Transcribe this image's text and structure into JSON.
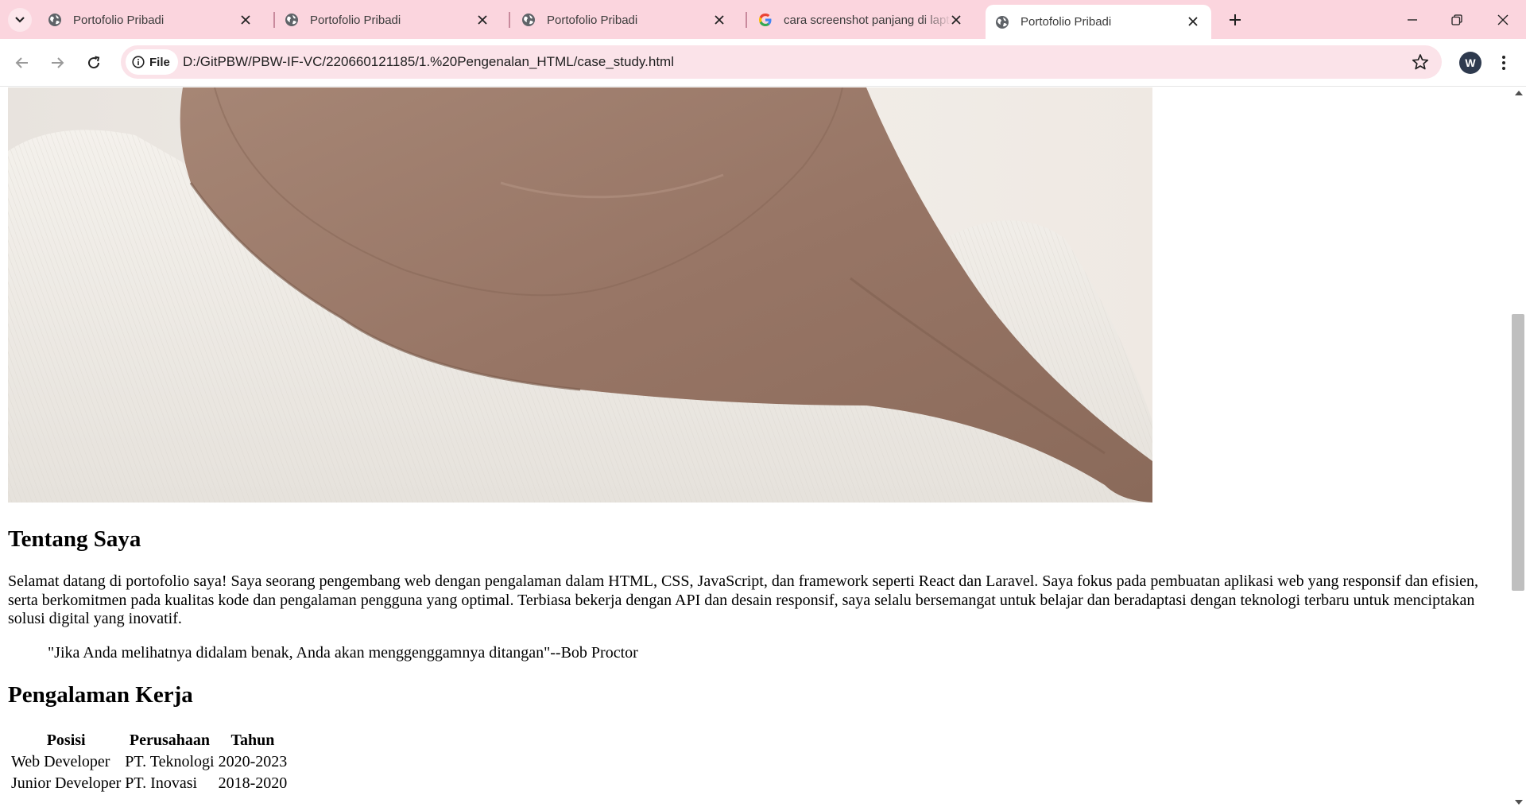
{
  "browser": {
    "tabs": [
      {
        "title": "Portofolio Pribadi",
        "icon": "globe-icon",
        "active": false
      },
      {
        "title": "Portofolio Pribadi",
        "icon": "globe-icon",
        "active": false
      },
      {
        "title": "Portofolio Pribadi",
        "icon": "globe-icon",
        "active": false
      },
      {
        "title": "cara screenshot panjang di laptop",
        "icon": "google-icon",
        "active": false
      },
      {
        "title": "Portofolio Pribadi",
        "icon": "globe-icon",
        "active": true
      }
    ],
    "address": {
      "scheme_label": "File",
      "url": "D:/GitPBW/PBW-IF-VC/220660121185/1.%20Pengenalan_HTML/case_study.html"
    },
    "profile_initial": "W",
    "colors": {
      "tabstrip_bg": "#fbd5de",
      "omnibox_bg": "#fbe3e9",
      "avatar_bg": "#2e3a4e"
    }
  },
  "page": {
    "photo": {
      "subject": "person in white knit sweater and taupe hijab (cropped)"
    },
    "about": {
      "heading": "Tentang Saya",
      "text": "Selamat datang di portofolio saya! Saya seorang pengembang web dengan pengalaman dalam HTML, CSS, JavaScript, dan framework seperti React dan Laravel. Saya fokus pada pembuatan aplikasi web yang responsif dan efisien, serta berkomitmen pada kualitas kode dan pengalaman pengguna yang optimal. Terbiasa bekerja dengan API dan desain responsif, saya selalu bersemangat untuk belajar dan beradaptasi dengan teknologi terbaru untuk menciptakan solusi digital yang inovatif.",
      "quote": "\"Jika Anda melihatnya didalam benak, Anda akan menggenggamnya ditangan\"--Bob Proctor"
    },
    "experience": {
      "heading": "Pengalaman Kerja",
      "columns": [
        "Posisi",
        "Perusahaan",
        "Tahun"
      ],
      "rows": [
        [
          "Web Developer",
          "PT. Teknologi",
          "2020-2023"
        ],
        [
          "Junior Developer",
          "PT. Inovasi",
          "2018-2020"
        ]
      ]
    }
  }
}
